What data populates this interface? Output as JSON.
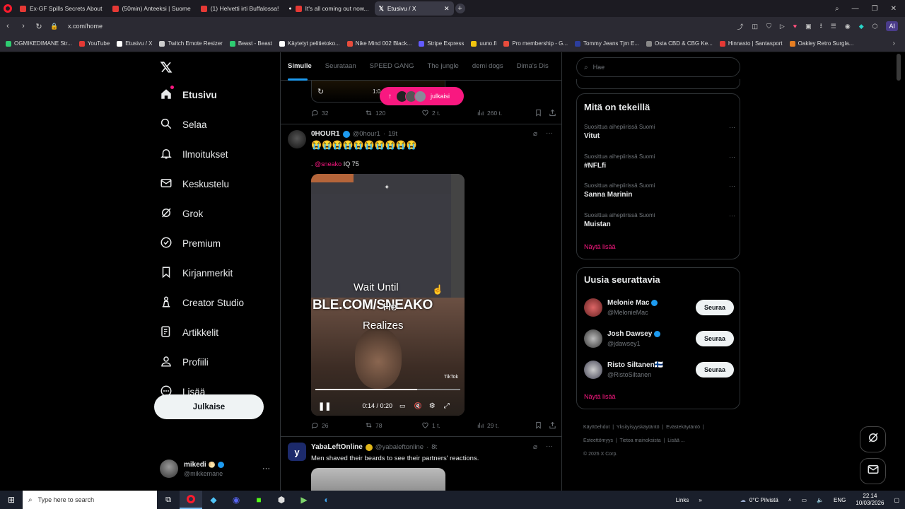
{
  "browser": {
    "tabs": [
      {
        "label": "Ex-GF Spills Secrets About",
        "color": "#e53935"
      },
      {
        "label": "(50min) Anteeksi | Suome",
        "color": "#e53935"
      },
      {
        "label": "(1) Helvetti irti Buffalossa!",
        "color": "#e53935"
      },
      {
        "label": "It's all coming out now...",
        "color": "#e53935"
      },
      {
        "label": "Etusivu / X",
        "color": "#ffffff"
      }
    ],
    "url": "x.com/home",
    "bookmarks": [
      "OGMIKEDIMANE Str...",
      "YouTube",
      "Etusivu / X",
      "Twitch Emote Resizer",
      "Beast - Beast",
      "Käytetyt pelitietoko...",
      "Nike Mind 002 Black...",
      "Stripe Express",
      "uuno.fi",
      "Pro membership - G...",
      "Tommy Jeans Tjm E...",
      "Osta CBD & CBG Ke...",
      "Hinnasto | Santasport",
      "Oakley Retro Surgla..."
    ]
  },
  "nav": {
    "items": [
      "Etusivu",
      "Selaa",
      "Ilmoitukset",
      "Keskustelu",
      "Grok",
      "Premium",
      "Kirjanmerkit",
      "Creator Studio",
      "Artikkelit",
      "Profiili",
      "Lisää"
    ],
    "post_label": "Julkaise",
    "account": {
      "name": "mikedi",
      "handle": "@mikkemane"
    }
  },
  "feed": {
    "tabs": [
      "Simulle",
      "Seurataan",
      "SPEED GANG",
      "The jungle",
      "demi dogs",
      "Dima's Dis"
    ],
    "new_posts_pill": "julkaisi",
    "prev_post": {
      "time_overlay": "1:0",
      "replies": "32",
      "reposts": "120",
      "likes": "2 t.",
      "views": "260 t."
    },
    "post1": {
      "name": "0HOUR1",
      "handle": "@0hour1",
      "age": "19t",
      "emojis": "😭😭😭😭😭😭😭😭😭😭",
      "mention": "@sneako",
      "text": "IQ 75",
      "video": {
        "caption_1": "Wait Until",
        "caption_2": "He",
        "caption_3": "Realizes",
        "url_overlay": "BLE.COM/SNEAKO",
        "tiktok": "TikTok",
        "time": "0:14 / 0:20",
        "progress": 0.7
      },
      "replies": "26",
      "reposts": "78",
      "likes": "1 t.",
      "views": "29 t."
    },
    "post2": {
      "name": "YabaLeftOnline",
      "handle": "@yabaleftonline",
      "age": "8t",
      "text": "Men shaved their beards to see their partners' reactions."
    }
  },
  "search": {
    "placeholder": "Hae"
  },
  "trends": {
    "title": "Mitä on tekeillä",
    "items": [
      {
        "category": "Suosittua aihepiirissä Suomi",
        "name": "Vitut"
      },
      {
        "category": "Suosittua aihepiirissä Suomi",
        "name": "#NFLfi"
      },
      {
        "category": "Suosittua aihepiirissä Suomi",
        "name": "Sanna Marinin"
      },
      {
        "category": "Suosittua aihepiirissä Suomi",
        "name": "Muistan"
      }
    ],
    "show_more": "Näytä lisää"
  },
  "who_to_follow": {
    "title": "Uusia seurattavia",
    "users": [
      {
        "name": "Melonie Mac",
        "handle": "@MelonieMac"
      },
      {
        "name": "Josh Dawsey",
        "handle": "@jdawsey1"
      },
      {
        "name": "Risto Siltanen🇫🇮",
        "handle": "@RistoSiltanen"
      }
    ],
    "follow_label": "Seuraa",
    "show_more": "Näytä lisää"
  },
  "footer": {
    "links": [
      "Käyttöehdot",
      "Yksityisyyskäytäntö",
      "Evästekäytäntö",
      "Esteettömyys",
      "Tietoa mainoksista",
      "Lisää ..."
    ],
    "copyright": "© 2026 X Corp."
  },
  "taskbar": {
    "search_placeholder": "Type here to search",
    "links": "Links",
    "weather": "0°C  Pilvistä",
    "lang": "ENG",
    "time": "22.14",
    "date": "10/03/2026"
  },
  "colors": {
    "accent": "#1d9bf0",
    "pink": "#f91880",
    "verified": "#1d9bf0"
  }
}
